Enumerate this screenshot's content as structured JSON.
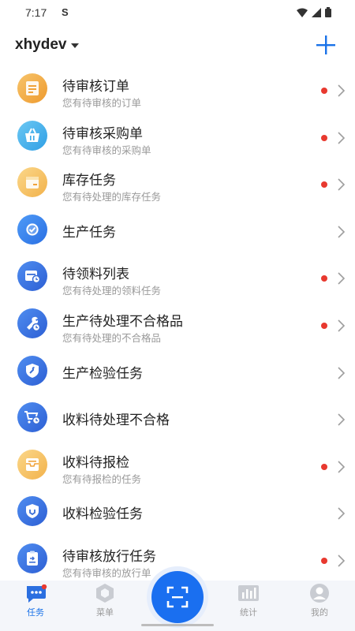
{
  "status_bar": {
    "time": "7:17",
    "extra": "S"
  },
  "header": {
    "account": "xhydev",
    "add_icon": "plus-icon"
  },
  "colors": {
    "accent": "#1a72e8",
    "badge": "#e8392f",
    "orange": "#f0a23a",
    "blue": "#3b6fd6",
    "cyan": "#3aaae8"
  },
  "tasks": [
    {
      "title": "待审核订单",
      "subtitle": "您有待审核的订单",
      "badge": true,
      "icon": "order-icon"
    },
    {
      "title": "待审核采购单",
      "subtitle": "您有待审核的采购单",
      "badge": true,
      "icon": "basket-icon"
    },
    {
      "title": "库存任务",
      "subtitle": "您有待处理的库存任务",
      "badge": true,
      "icon": "inventory-icon"
    },
    {
      "title": "生产任务",
      "subtitle": "",
      "badge": false,
      "icon": "check-icon"
    },
    {
      "title": "待领料列表",
      "subtitle": "您有待处理的领料任务",
      "badge": true,
      "icon": "material-icon"
    },
    {
      "title": "生产待处理不合格品",
      "subtitle": "您有待处理的不合格品",
      "badge": true,
      "icon": "wrench-clock-icon"
    },
    {
      "title": "生产检验任务",
      "subtitle": "",
      "badge": false,
      "icon": "shield-wrench-icon"
    },
    {
      "title": "收料待处理不合格",
      "subtitle": "",
      "badge": false,
      "icon": "cart-clock-icon"
    },
    {
      "title": "收料待报检",
      "subtitle": "您有待报检的任务",
      "badge": true,
      "icon": "inbox-icon"
    },
    {
      "title": "收料检验任务",
      "subtitle": "",
      "badge": false,
      "icon": "shield-icon"
    },
    {
      "title": "待审核放行任务",
      "subtitle": "您有待审核的放行单",
      "badge": true,
      "icon": "clipboard-icon"
    }
  ],
  "tabbar": {
    "tasks": "任务",
    "menu": "菜单",
    "scan_icon": "scan-icon",
    "stats": "统计",
    "mine": "我的"
  }
}
